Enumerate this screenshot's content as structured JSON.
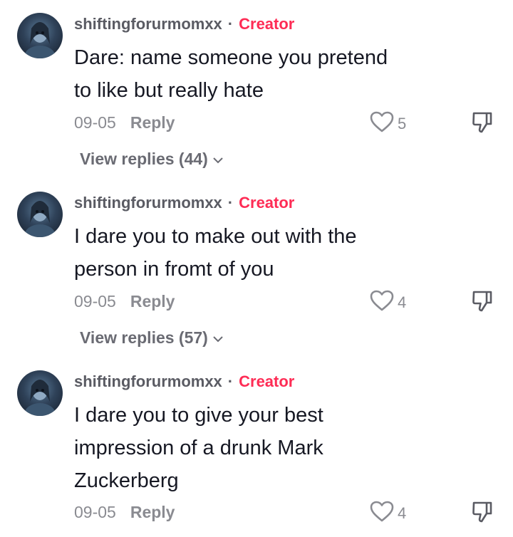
{
  "comments": [
    {
      "username": "shiftingforurmomxx",
      "separator": "·",
      "badge": "Creator",
      "lines": [
        "Dare: name someone you pretend",
        "to like but really hate"
      ],
      "date": "09-05",
      "reply_label": "Reply",
      "likes": "5",
      "view_replies": "View replies (44)"
    },
    {
      "username": "shiftingforurmomxx",
      "separator": "·",
      "badge": "Creator",
      "lines": [
        "I dare you to make out with the",
        "person in fromt of you"
      ],
      "date": "09-05",
      "reply_label": "Reply",
      "likes": "4",
      "view_replies": "View replies (57)"
    },
    {
      "username": "shiftingforurmomxx",
      "separator": "·",
      "badge": "Creator",
      "lines": [
        "I dare you to give your best",
        "impression of a drunk Mark",
        "Zuckerberg"
      ],
      "date": "09-05",
      "reply_label": "Reply",
      "likes": "4"
    }
  ],
  "colors": {
    "creator_badge": "#fe2c55",
    "text": "#161823",
    "muted": "#8a8b91"
  },
  "icons": {
    "avatar": "avatar-image",
    "like": "heart-outline-icon",
    "dislike": "thumbs-down-icon",
    "expand": "chevron-down-icon"
  }
}
